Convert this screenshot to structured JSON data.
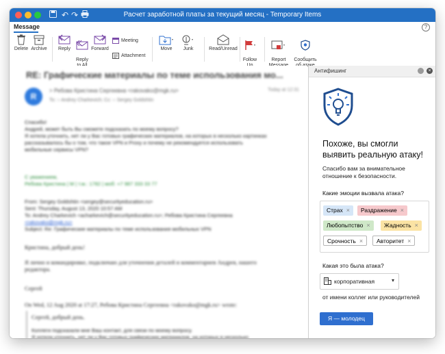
{
  "window": {
    "title": "Расчет заработной платы за текущий месяц - Temporary Items"
  },
  "tabs": {
    "message_label": "Message",
    "help_label": "?"
  },
  "ribbon": {
    "delete_label": "Delete",
    "archive_label": "Archive",
    "reply_label": "Reply",
    "reply_all_label": "Reply\nto All",
    "forward_label": "Forward",
    "meeting_label": "Meeting",
    "attachment_label": "Attachment",
    "move_label": "Move",
    "junk_label": "Junk",
    "read_unread_label": "Read/Unread",
    "follow_up_label": "Follow\nUp",
    "report_message_label": "Report\nMessage",
    "report_attack_label": "Сообщить\nоб атаке"
  },
  "email": {
    "subject": "RE: Графические материалы по теме использования мо...",
    "avatar_initial": "R",
    "from": "> Ребова Кристина Сергеевна <rakovako@mgk.ru>",
    "to": "To: ○ Andrey Charkevich;   Cc: ○ Sergey Goldshtin",
    "time": "Today at 12:31",
    "greeting": "Спасибо!",
    "body_p1": "Андрей, может быть Вы сможете подсказать по моему вопросу?\nЯ хотела уточнить, нет ли у Вас готовых графических материалов, на которых в несколько картинках\nрассказывалось бы о том, что такое VPN и Proxy и почему не рекомендуется использовать\nмобильные сервисы VPN?",
    "signature": "С уважением,\nРебова Кристина | М | т.м.: 1782 | моб: +7 987 333 33 77",
    "from_label": "From: Sergey Goldshtin <sergey@securityeducation.ru>",
    "sent_label": "Sent: Thursday, August 13, 2020 10:57 AM",
    "to_label": "To: Andrey Charkevich <acharkevich@securityeducation.ru>; Ребова Кристина Сергеевна",
    "to_label2": "<rakovako@mgk.ru>",
    "subject_label": "Subject: Re: Графические материалы по теме использования мобильных VPN",
    "quoted_greeting": "Кристина, добрый день!",
    "quoted_p": "Я лично и командировке, подключаю для уточнения деталей и комментариев Андрея, нашего\nредактора.",
    "quoted_name": "Сергей",
    "on_wrote": "On Wed, 12 Aug 2020 at 17:27, Ребова Кристина Сергеевна <rakovako@mgk.ru> wrote:",
    "quoted2_greeting": "Сергей, добрый день.",
    "quoted2_p": "Коллеги подсказали мне Ваш контакт, для связи по моему вопросу.\nЯ хотела уточнить, нет ли у Вас готовых графических материалов, на которых в несколько"
  },
  "panel": {
    "title": "Антифишинг",
    "heading": "Похоже, вы смогли выявить реальную атаку!",
    "thanks": "Спасибо вам за внимательное отношение к безопасности.",
    "emotions_question": "Какие эмоции вызвала атака?",
    "chips": [
      {
        "label": "Страх",
        "bg": "#d6e6f7"
      },
      {
        "label": "Раздражение",
        "bg": "#f6c9cc"
      },
      {
        "label": "Любопытство",
        "bg": "#cfe8c8"
      },
      {
        "label": "Жадность",
        "bg": "#fbe3a4"
      },
      {
        "label": "Срочность",
        "bg": "#ffffff"
      },
      {
        "label": "Авторитет",
        "bg": "#ffffff"
      }
    ],
    "attack_type_question": "Какая это была атака?",
    "attack_type_value": "корпоративная",
    "attack_type_hint": "от имени коллег или руководителей",
    "submit_label": "Я — молодец"
  },
  "colors": {
    "titlebar": "#2470c4",
    "accent": "#2f6fcf",
    "shield_dark": "#1f4d8f"
  }
}
